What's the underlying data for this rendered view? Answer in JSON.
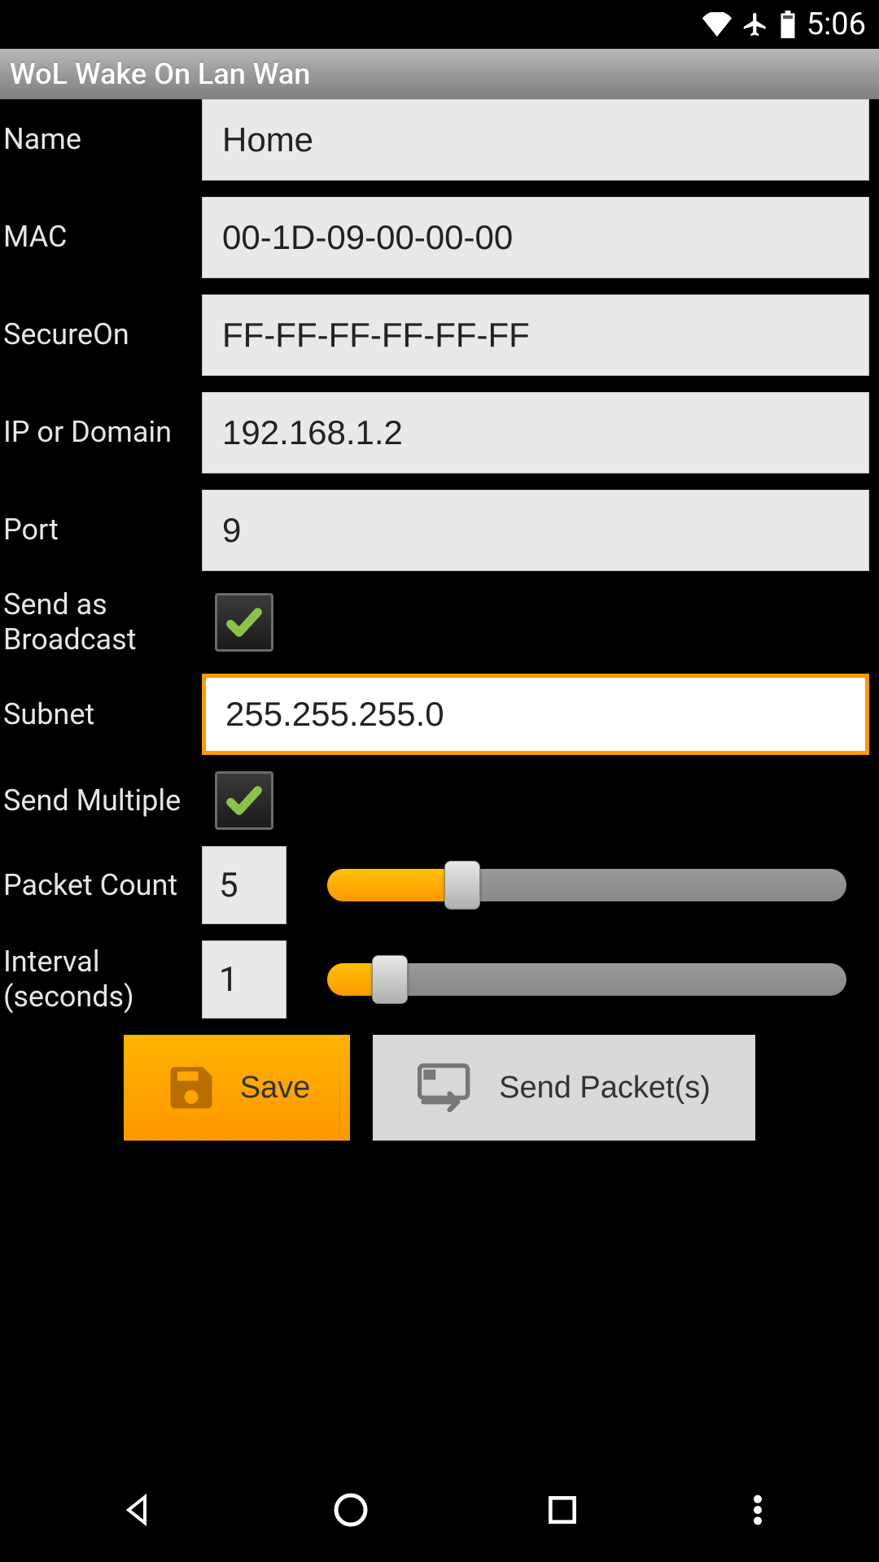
{
  "statusbar": {
    "time": "5:06"
  },
  "titlebar": {
    "title": "WoL Wake On Lan Wan"
  },
  "form": {
    "name": {
      "label": "Name",
      "value": "Home"
    },
    "mac": {
      "label": "MAC",
      "value": "00-1D-09-00-00-00"
    },
    "secureon": {
      "label": "SecureOn",
      "value": "FF-FF-FF-FF-FF-FF"
    },
    "ip": {
      "label": "IP or Domain",
      "value": "192.168.1.2"
    },
    "port": {
      "label": "Port",
      "value": "9"
    },
    "broadcast": {
      "label": "Send as Broadcast",
      "checked": true
    },
    "subnet": {
      "label": "Subnet",
      "value": "255.255.255.0",
      "focused": true
    },
    "multiple": {
      "label": "Send Multiple",
      "checked": true
    },
    "packetcount": {
      "label": "Packet Count",
      "value": "5",
      "slider_min": 0,
      "slider_max": 20,
      "slider_pos_pct": 26
    },
    "interval": {
      "label": "Interval (seconds)",
      "value": "1",
      "slider_min": 0,
      "slider_max": 10,
      "slider_pos_pct": 12
    }
  },
  "buttons": {
    "save": "Save",
    "send": "Send Packet(s)"
  },
  "colors": {
    "accent": "#ff9800",
    "check": "#8bc34a"
  }
}
